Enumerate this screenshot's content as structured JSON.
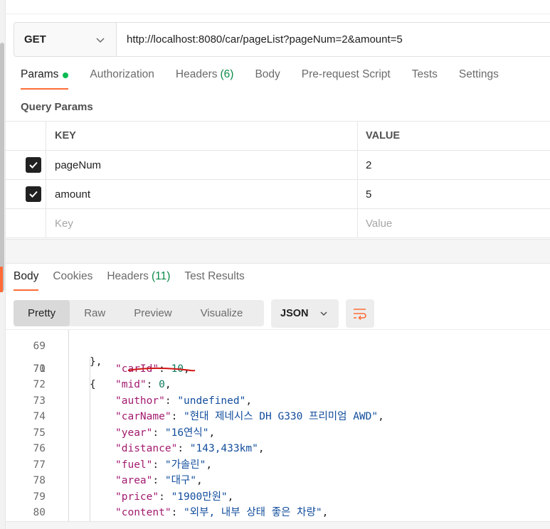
{
  "request": {
    "method": "GET",
    "url": "http://localhost:8080/car/pageList?pageNum=2&amount=5"
  },
  "request_tabs": [
    {
      "label": "Params",
      "active": true,
      "dot": true
    },
    {
      "label": "Authorization"
    },
    {
      "label": "Headers",
      "count": "(6)"
    },
    {
      "label": "Body"
    },
    {
      "label": "Pre-request Script"
    },
    {
      "label": "Tests"
    },
    {
      "label": "Settings"
    }
  ],
  "query_params": {
    "title": "Query Params",
    "header": {
      "key": "KEY",
      "value": "VALUE"
    },
    "rows": [
      {
        "key": "pageNum",
        "value": "2",
        "checked": true
      },
      {
        "key": "amount",
        "value": "5",
        "checked": true
      }
    ],
    "placeholder": {
      "key": "Key",
      "value": "Value"
    }
  },
  "response_tabs": [
    {
      "label": "Body",
      "active": true
    },
    {
      "label": "Cookies"
    },
    {
      "label": "Headers",
      "count": "(11)"
    },
    {
      "label": "Test Results"
    }
  ],
  "view_modes": [
    "Pretty",
    "Raw",
    "Preview",
    "Visualize"
  ],
  "active_view": "Pretty",
  "format": "JSON",
  "code": {
    "partial_top": {
      "num": "69",
      "text": "},"
    },
    "lines": [
      {
        "num": "70",
        "text": "{"
      },
      {
        "num": "71",
        "key": "\"carId\"",
        "value": "10",
        "type": "num"
      },
      {
        "num": "72",
        "key": "\"mid\"",
        "value": "0",
        "type": "num"
      },
      {
        "num": "73",
        "key": "\"author\"",
        "value": "\"undefined\"",
        "type": "str"
      },
      {
        "num": "74",
        "key": "\"carName\"",
        "value": "\"현대 제네시스 DH G330 프리미엄 AWD\"",
        "type": "str"
      },
      {
        "num": "75",
        "key": "\"year\"",
        "value": "\"16연식\"",
        "type": "str"
      },
      {
        "num": "76",
        "key": "\"distance\"",
        "value": "\"143,433km\"",
        "type": "str"
      },
      {
        "num": "77",
        "key": "\"fuel\"",
        "value": "\"가솔린\"",
        "type": "str"
      },
      {
        "num": "78",
        "key": "\"area\"",
        "value": "\"대구\"",
        "type": "str"
      },
      {
        "num": "79",
        "key": "\"price\"",
        "value": "\"1900만원\"",
        "type": "str"
      },
      {
        "num": "80",
        "key": "\"content\"",
        "value": "\"외부, 내부 상태 좋은 차량\"",
        "type": "str"
      }
    ]
  },
  "colors": {
    "accent": "#ff6c37",
    "dot": "#0cbb52",
    "json_key": "#a11a6f",
    "json_string": "#124d9c",
    "json_number": "#0f7a5c",
    "annotation": "#d11414"
  },
  "icons": [
    "chevron-down-icon",
    "check-icon",
    "wrap-lines-icon"
  ]
}
